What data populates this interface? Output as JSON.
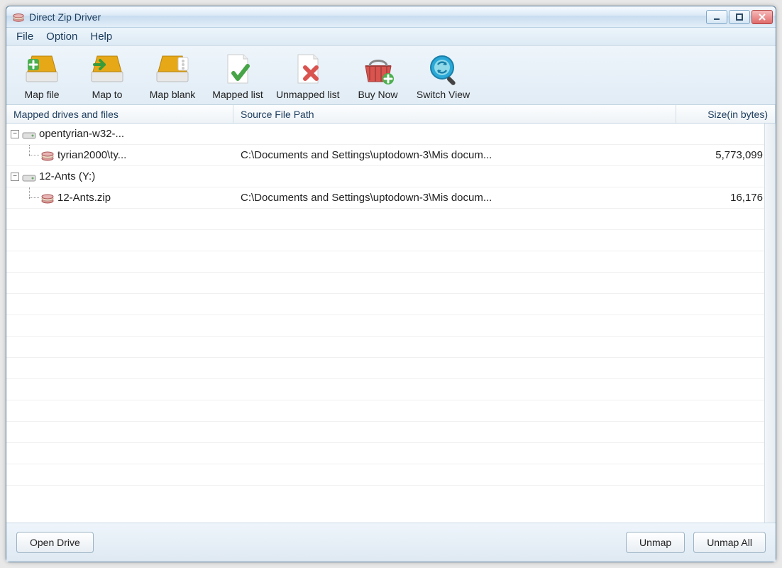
{
  "window": {
    "title": "Direct Zip Driver"
  },
  "menu": {
    "file": "File",
    "option": "Option",
    "help": "Help"
  },
  "toolbar": {
    "map_file": "Map file",
    "map_to": "Map to",
    "map_blank": "Map blank",
    "mapped_list": "Mapped list",
    "unmapped_list": "Unmapped list",
    "buy_now": "Buy Now",
    "switch_view": "Switch View"
  },
  "columns": {
    "name": "Mapped drives and files",
    "path": "Source File Path",
    "size": "Size(in bytes)"
  },
  "tree": [
    {
      "drive_label": "opentyrian-w32-...",
      "file_label": "tyrian2000\\ty...",
      "file_path": "C:\\Documents and Settings\\uptodown-3\\Mis docum...",
      "file_size": "5,773,099"
    },
    {
      "drive_label": "12-Ants (Y:)",
      "file_label": "12-Ants.zip",
      "file_path": "C:\\Documents and Settings\\uptodown-3\\Mis docum...",
      "file_size": "16,176"
    }
  ],
  "buttons": {
    "open_drive": "Open Drive",
    "unmap": "Unmap",
    "unmap_all": "Unmap All"
  }
}
